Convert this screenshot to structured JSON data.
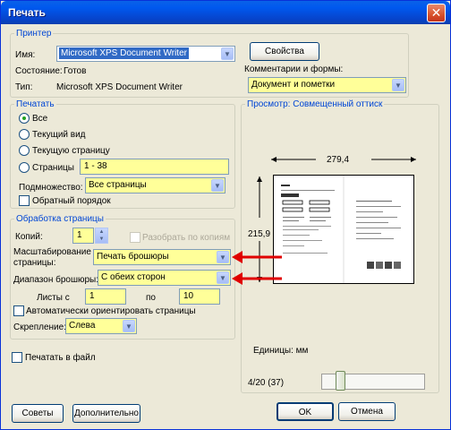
{
  "window": {
    "title": "Печать"
  },
  "printer_group": {
    "legend": "Принтер",
    "name_label": "Имя:",
    "name_value": "Microsoft XPS Document Writer",
    "properties_button": "Свойства",
    "status_label": "Состояние:",
    "status_value": "Готов",
    "type_label": "Тип:",
    "type_value": "Microsoft XPS Document Writer",
    "comments_label": "Комментарии и формы:",
    "comments_value": "Документ и пометки"
  },
  "print_range": {
    "legend": "Печатать",
    "all_label": "Все",
    "current_view_label": "Текущий вид",
    "current_page_label": "Текущую страницу",
    "pages_label": "Страницы",
    "pages_value": "1 - 38",
    "subset_label": "Подмножество:",
    "subset_value": "Все страницы",
    "reverse_label": "Обратный порядок"
  },
  "page_handling": {
    "legend": "Обработка страницы",
    "copies_label": "Копий:",
    "copies_value": "1",
    "collate_label": "Разобрать по копиям",
    "scaling_label_1": "Масштабирование",
    "scaling_label_2": "страницы:",
    "scaling_value": "Печать брошюры",
    "booklet_label": "Диапазон брошюры:",
    "booklet_value": "С обеих сторон",
    "sheets_from_label": "Листы с",
    "sheets_from_value": "1",
    "sheets_to_label": "по",
    "sheets_to_value": "10",
    "auto_rotate_label": "Автоматически ориентировать страницы",
    "binding_label": "Скрепление:",
    "binding_value": "Слева"
  },
  "print_to_file_label": "Печатать в файл",
  "preview": {
    "legend": "Просмотр: Совмещенный оттиск",
    "width_value": "279,4",
    "height_value": "215,9",
    "units_label": "Единицы: мм",
    "page_counter": "4/20 (37)"
  },
  "buttons": {
    "tips": "Советы",
    "advanced": "Дополнительно",
    "ok": "OK",
    "cancel": "Отмена"
  },
  "colors": {
    "annotation_arrow": "#e00000",
    "highlight_field": "#ffff99"
  }
}
